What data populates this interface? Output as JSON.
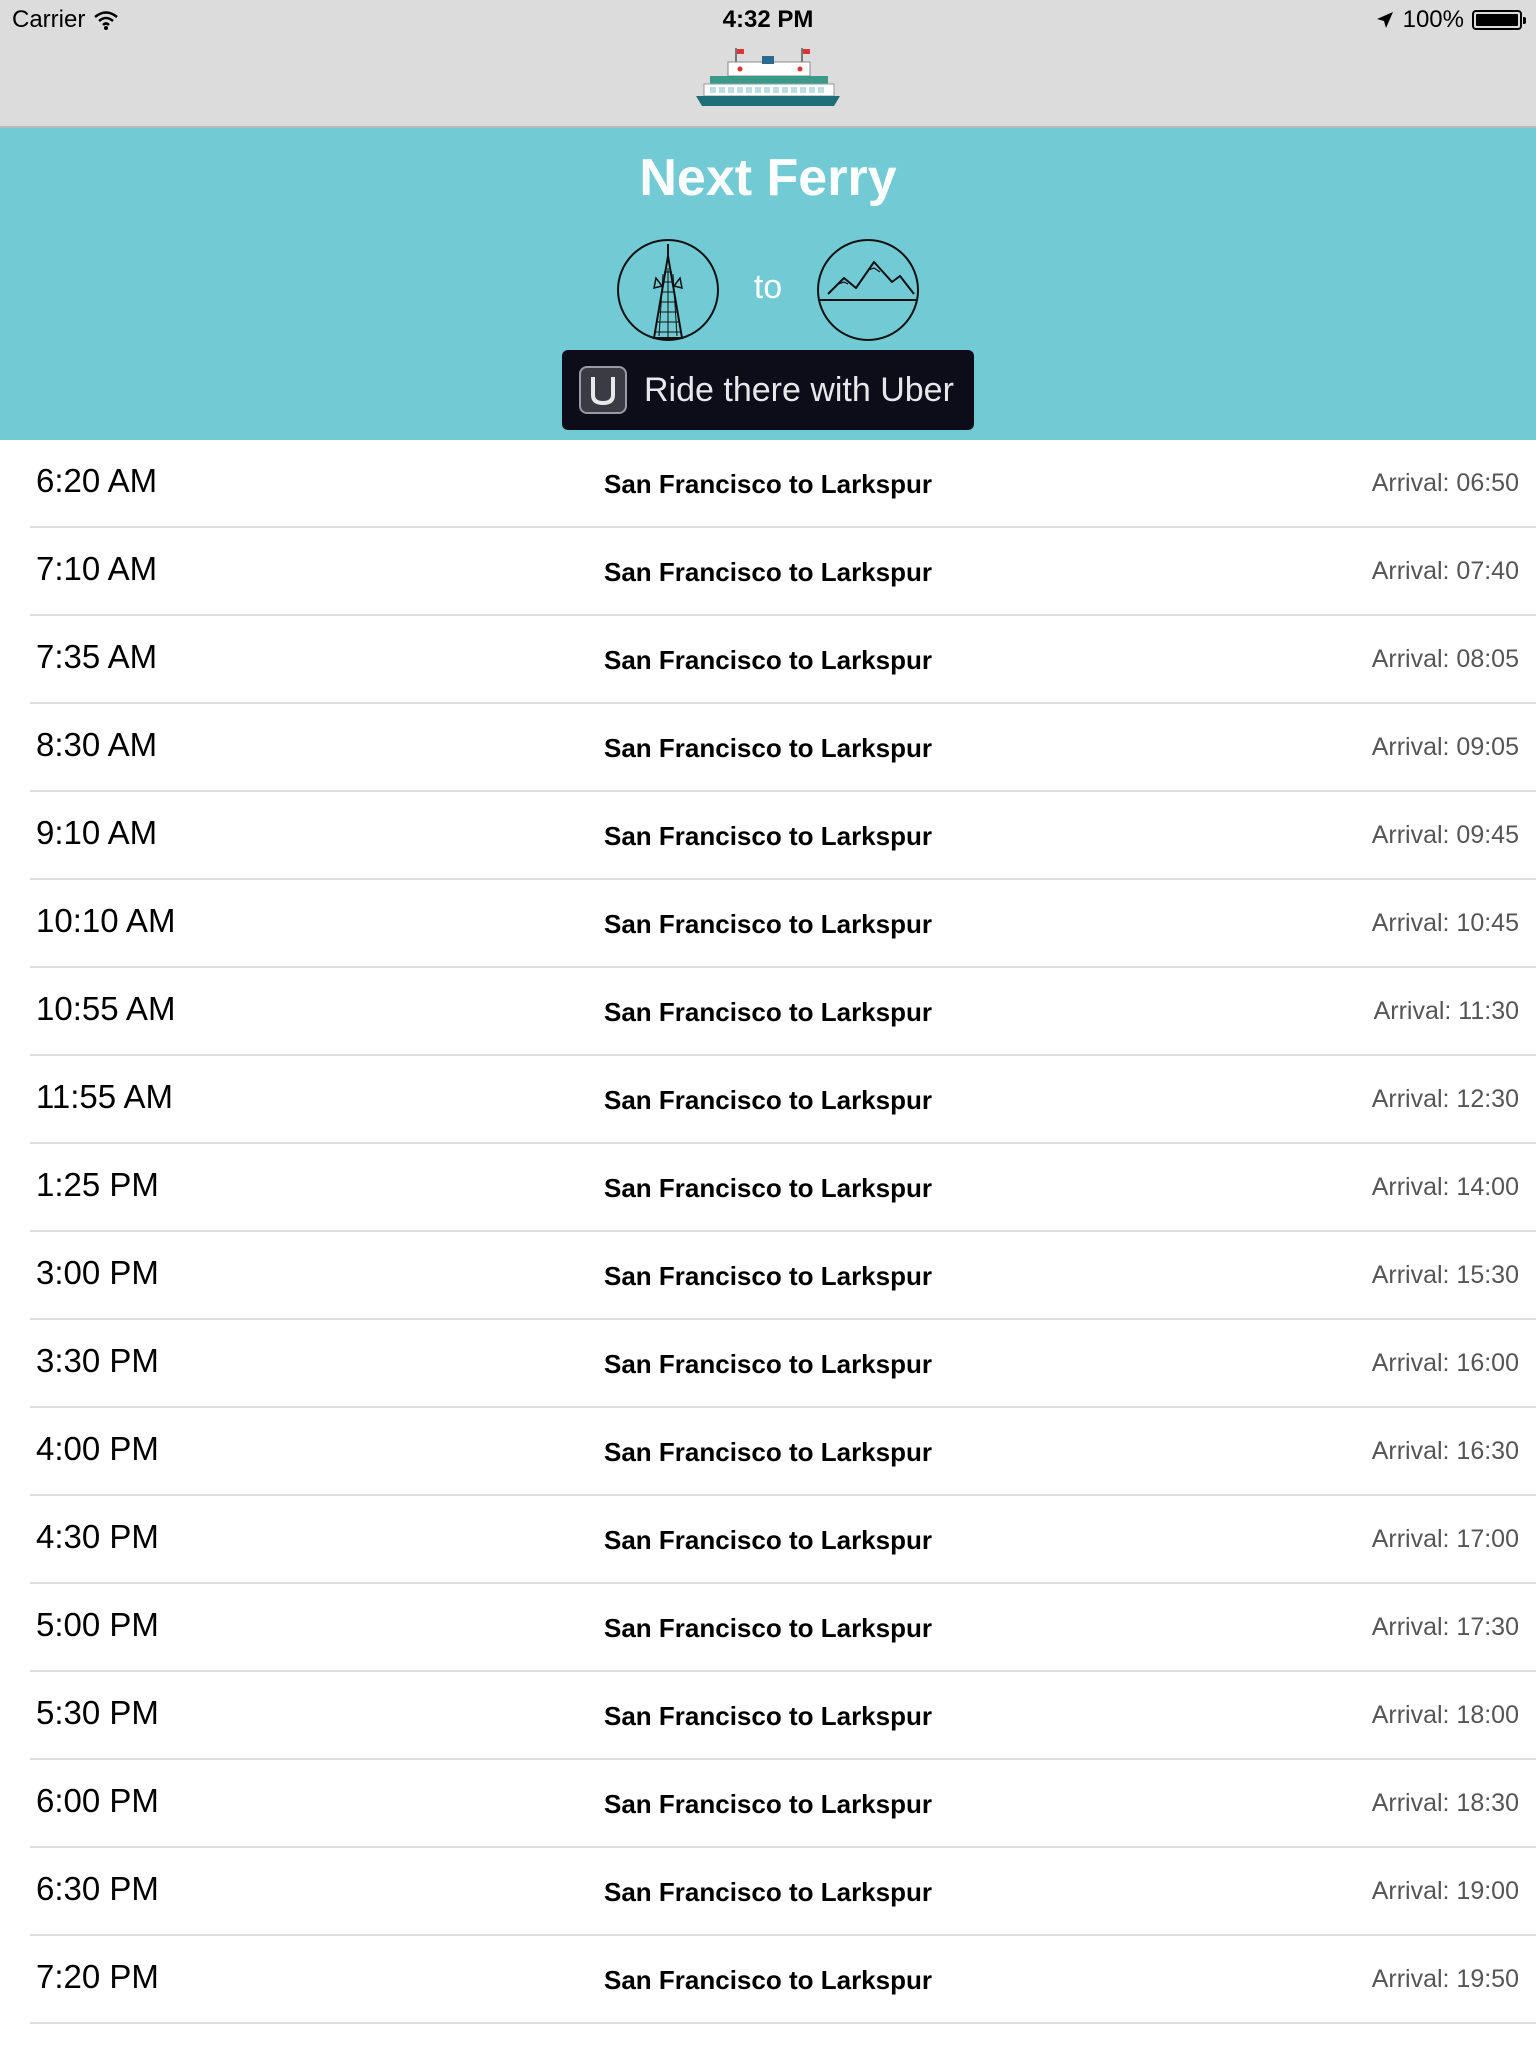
{
  "status_bar": {
    "carrier": "Carrier",
    "time": "4:32 PM",
    "battery": "100%",
    "battery_level": 1.0
  },
  "nav": {
    "logo_icon": "ferry-boat-icon"
  },
  "header": {
    "title": "Next Ferry",
    "origin_icon": "transamerica-pyramid-icon",
    "to_label": "to",
    "destination_icon": "mountain-icon",
    "uber_button_label": "Ride there with Uber",
    "uber_icon": "uber-logo-icon",
    "background_color": "#72cad4"
  },
  "departures": [
    {
      "departure": "6:20 AM",
      "route": "San Francisco to Larkspur",
      "arrival": "Arrival: 06:50"
    },
    {
      "departure": "7:10 AM",
      "route": "San Francisco to Larkspur",
      "arrival": "Arrival: 07:40"
    },
    {
      "departure": "7:35 AM",
      "route": "San Francisco to Larkspur",
      "arrival": "Arrival: 08:05"
    },
    {
      "departure": "8:30 AM",
      "route": "San Francisco to Larkspur",
      "arrival": "Arrival: 09:05"
    },
    {
      "departure": "9:10 AM",
      "route": "San Francisco to Larkspur",
      "arrival": "Arrival: 09:45"
    },
    {
      "departure": "10:10 AM",
      "route": "San Francisco to Larkspur",
      "arrival": "Arrival: 10:45"
    },
    {
      "departure": "10:55 AM",
      "route": "San Francisco to Larkspur",
      "arrival": "Arrival: 11:30"
    },
    {
      "departure": "11:55 AM",
      "route": "San Francisco to Larkspur",
      "arrival": "Arrival: 12:30"
    },
    {
      "departure": "1:25 PM",
      "route": "San Francisco to Larkspur",
      "arrival": "Arrival: 14:00"
    },
    {
      "departure": "3:00 PM",
      "route": "San Francisco to Larkspur",
      "arrival": "Arrival: 15:30"
    },
    {
      "departure": "3:30 PM",
      "route": "San Francisco to Larkspur",
      "arrival": "Arrival: 16:00"
    },
    {
      "departure": "4:00 PM",
      "route": "San Francisco to Larkspur",
      "arrival": "Arrival: 16:30"
    },
    {
      "departure": "4:30 PM",
      "route": "San Francisco to Larkspur",
      "arrival": "Arrival: 17:00"
    },
    {
      "departure": "5:00 PM",
      "route": "San Francisco to Larkspur",
      "arrival": "Arrival: 17:30"
    },
    {
      "departure": "5:30 PM",
      "route": "San Francisco to Larkspur",
      "arrival": "Arrival: 18:00"
    },
    {
      "departure": "6:00 PM",
      "route": "San Francisco to Larkspur",
      "arrival": "Arrival: 18:30"
    },
    {
      "departure": "6:30 PM",
      "route": "San Francisco to Larkspur",
      "arrival": "Arrival: 19:00"
    },
    {
      "departure": "7:20 PM",
      "route": "San Francisco to Larkspur",
      "arrival": "Arrival: 19:50"
    }
  ]
}
